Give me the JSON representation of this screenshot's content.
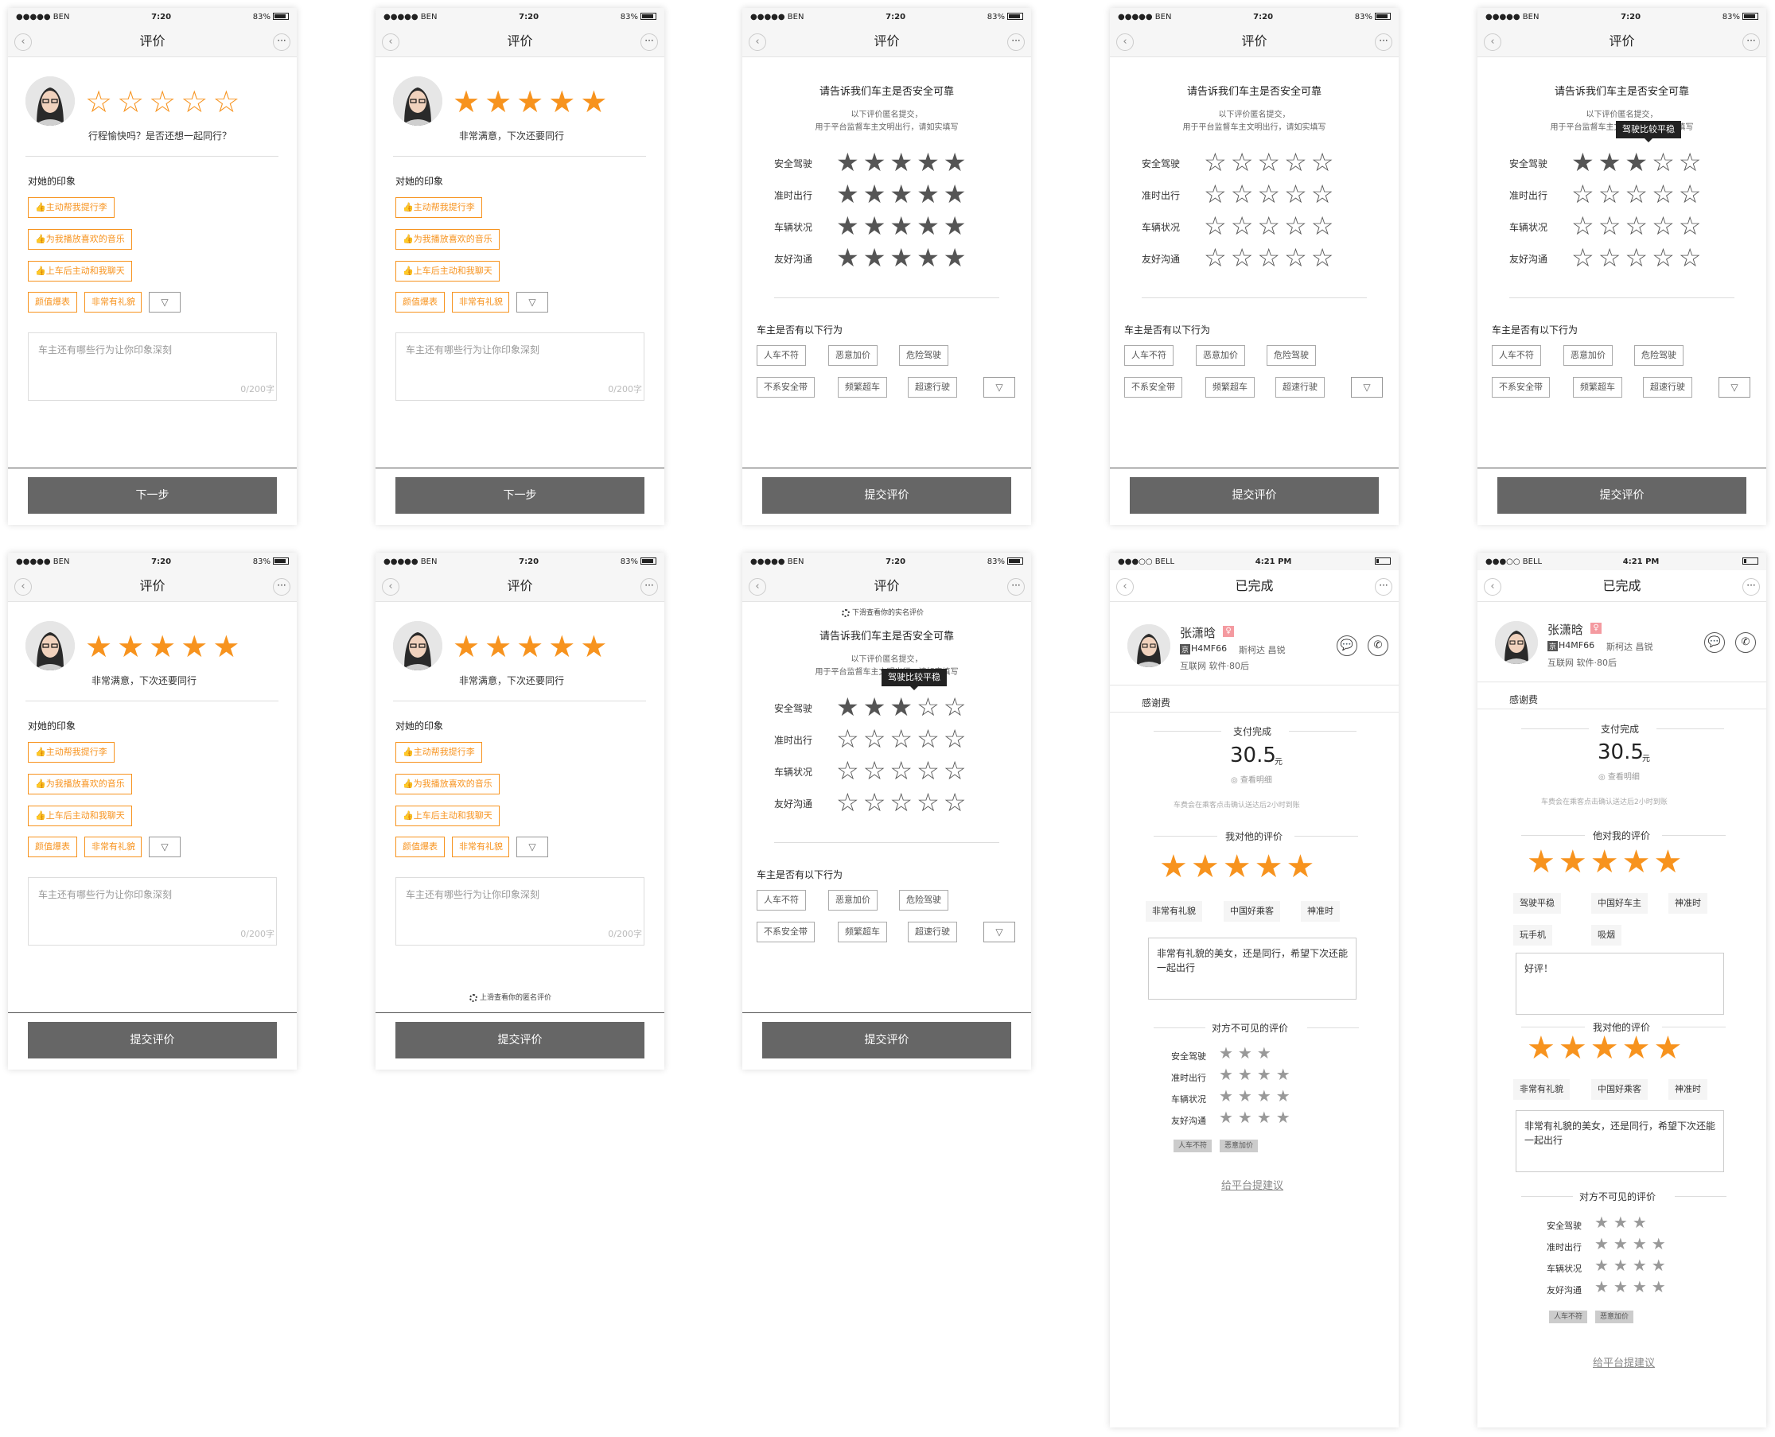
{
  "status": {
    "carrier": "●●●●● BEN",
    "time": "7:20",
    "battery": "83%"
  },
  "status2": {
    "carrier": "●●●○○ BELL",
    "time": "4:21 PM"
  },
  "nav": {
    "title": "评价",
    "done_title": "已完成",
    "back": "‹",
    "more": "···"
  },
  "s1": {
    "sub": "行程愉快吗？是否还想一起同行？"
  },
  "s2": {
    "sub": "非常满意，下次还要同行"
  },
  "s6": {
    "sub": "非常满意，下次还要同行"
  },
  "impression": {
    "title": "对她的印象",
    "tags": [
      "👍主动帮我提行李",
      "👍为我播放喜欢的音乐",
      "👍上车后主动和我聊天"
    ],
    "short": [
      "颜值爆表",
      "非常有礼貌"
    ],
    "dropdown": "▽"
  },
  "textarea": {
    "placeholder": "车主还有哪些行为让你印象深刻",
    "count": "0/200字"
  },
  "buttons": {
    "next": "下一步",
    "submit": "提交评价"
  },
  "safety": {
    "title": "请告诉我们车主是否安全可靠",
    "note1": "以下评价匿名提交，",
    "note2": "用于平台监督车主文明出行，请如实填写",
    "rows": [
      "安全驾驶",
      "准时出行",
      "车辆状况",
      "友好沟通"
    ],
    "tooltip": "驾驶比较平稳"
  },
  "behavior": {
    "title": "车主是否有以下行为",
    "tags": [
      "人车不符",
      "恶意加价",
      "危险驾驶",
      "不系安全带",
      "频繁超车",
      "超速行驶"
    ],
    "dropdown": "▽"
  },
  "hints": {
    "pull_down": "下滑查看你的实名评价",
    "pull_up": "上滑查看你的匿名评价"
  },
  "driver": {
    "name": "张潇晗",
    "badge": "♀",
    "plate_prefix": "京",
    "plate": "H4MF66",
    "car": "斯柯达 昌锐",
    "info": "互联网 软件·80后"
  },
  "done": {
    "thanks": "感谢费",
    "paid": "支付完成",
    "amount": "30.5",
    "unit": "元",
    "detail": "查看明细",
    "note": "车费会在乘客点击确认送达后2小时到账",
    "my_review": "我对他的评价",
    "his_review": "他对我的评价",
    "my_tags": [
      "非常有礼貌",
      "中国好乘客",
      "神准时"
    ],
    "his_tags": [
      "驾驶平稳",
      "中国好车主",
      "神准时",
      "玩手机",
      "吸烟"
    ],
    "my_text": "非常有礼貌的美女，还是同行，希望下次还能一起出行",
    "his_text": "好评！",
    "hidden": "对方不可见的评价",
    "hidden_tags": [
      "人车不符",
      "恶意加价"
    ],
    "suggest": "给平台提建议"
  },
  "icons": {
    "star": "star-icon",
    "back": "back-icon",
    "more": "more-icon",
    "chat": "chat-icon",
    "phone": "phone-icon"
  },
  "colors": {
    "orange": "#f7931e",
    "button": "#666666",
    "dark_star": "#555555"
  }
}
